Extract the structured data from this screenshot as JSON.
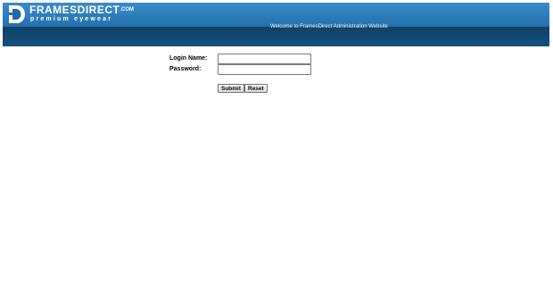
{
  "header": {
    "logo_name": "FRAMESDIRECT",
    "logo_com": ".COM",
    "logo_tagline": "premium eyewear",
    "welcome_text": "Welcome to FramesDirect Administration Website"
  },
  "login_form": {
    "login_name_label": "Login Name:",
    "login_name_value": "",
    "password_label": "Password:",
    "password_value": "",
    "submit_label": "Submit",
    "reset_label": "Reset"
  },
  "colors": {
    "header_top": "#2f7fc0",
    "header_bottom": "#0f4066",
    "background": "#ffffff"
  }
}
